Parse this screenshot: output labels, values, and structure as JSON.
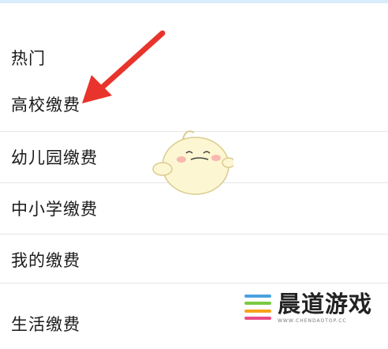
{
  "list": {
    "section_title": "热门",
    "items": [
      {
        "label": "高校缴费"
      },
      {
        "label": "幼儿园缴费"
      },
      {
        "label": "中小学缴费"
      },
      {
        "label": "我的缴费"
      },
      {
        "label": "生活缴费"
      }
    ]
  },
  "watermark": {
    "title": "晨道游戏",
    "subtitle": "WWW.CHENDAOTOP.CC"
  },
  "colors": {
    "arrow": "#e8342c",
    "divider": "#e6e6e6",
    "wm_blue": "#4aa3df",
    "wm_green": "#7ac943",
    "wm_orange": "#f7a21b",
    "wm_pink": "#e94c89"
  }
}
